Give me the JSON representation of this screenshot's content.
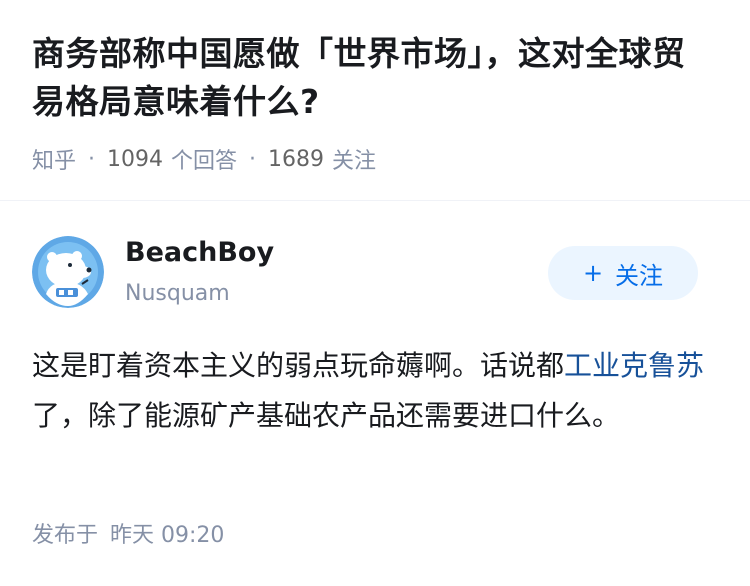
{
  "question": {
    "title": "商务部称中国愿做「世界市场」，这对全球贸易格局意味着什么?",
    "source": "知乎",
    "answer_count": "1094",
    "answer_label": "个回答",
    "follower_count": "1689",
    "follower_label": "关注"
  },
  "answer": {
    "author": {
      "name": "BeachBoy",
      "bio": "Nusquam",
      "avatar_icon": "polar-bear-avatar"
    },
    "follow_button": {
      "plus": "+",
      "label": "关注"
    },
    "content": {
      "text_before": "这是盯着资本主义的弱点玩命薅啊。话说都",
      "link_text": "工业克鲁苏",
      "text_after": "了，除了能源矿产基础农产品还需要进口什么。"
    },
    "publish": {
      "label": "发布于",
      "time": "昨天 09:20"
    }
  },
  "colors": {
    "link": "#175199",
    "follow_text": "#056de8",
    "follow_bg": "#ebf5ff",
    "meta": "#8590a6"
  }
}
